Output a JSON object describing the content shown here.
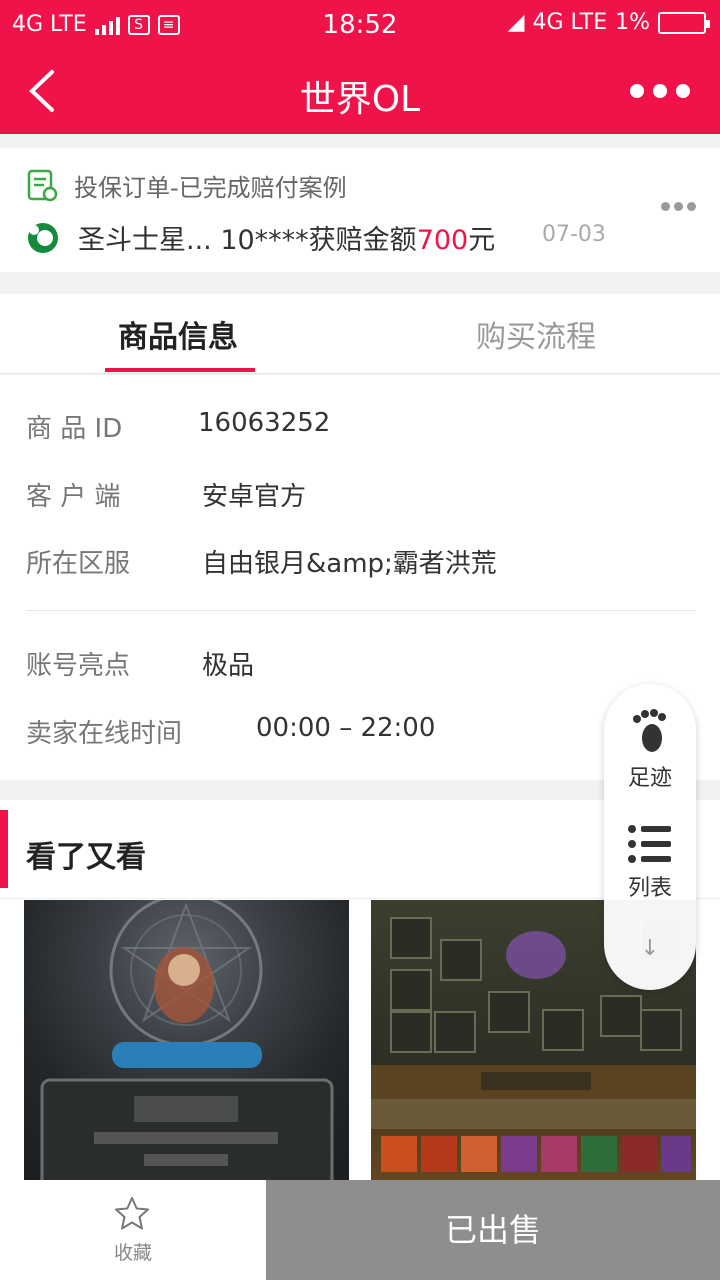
{
  "status_bar": {
    "left_network": "4G LTE",
    "time": "18:52",
    "right_network": "4G LTE",
    "battery": "1%"
  },
  "nav": {
    "title": "世界OL"
  },
  "notice": {
    "line1": "投保订单-已完成赔付案例",
    "line2_prefix": "圣斗士星... 10****获赔金额",
    "amount": "700",
    "line2_suffix": "元",
    "date": "07-03"
  },
  "tabs": [
    {
      "label": "商品信息",
      "active": true
    },
    {
      "label": "购买流程",
      "active": false
    }
  ],
  "info": {
    "rows": [
      {
        "label": "商 品 ID",
        "value": "16063252"
      },
      {
        "label": "客 户 端",
        "value": "安卓官方"
      },
      {
        "label": "所在区服",
        "value": "自由银月&amp;霸者洪荒"
      },
      {
        "label": "账号亮点",
        "value": "极品"
      },
      {
        "label": "卖家在线时间",
        "value": "00:00 – 22:00"
      }
    ]
  },
  "section": {
    "title": "看了又看"
  },
  "float_panel": {
    "footprint_label": "足迹",
    "list_label": "列表"
  },
  "bottom": {
    "favorite_label": "收藏",
    "sold_label": "已出售"
  },
  "colors": {
    "brand": "#f0134a",
    "sold_button": "#8e8e8e"
  }
}
